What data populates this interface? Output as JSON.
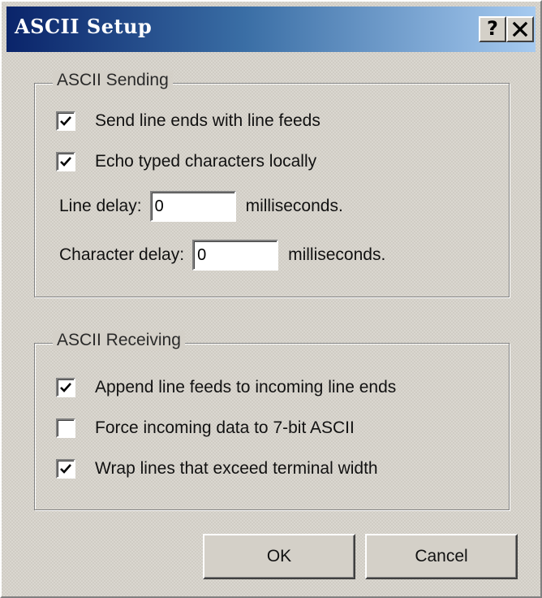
{
  "window": {
    "title": "ASCII Setup",
    "help_glyph": "?",
    "close_glyph": "✕"
  },
  "sending": {
    "legend": "ASCII Sending",
    "send_line_ends": {
      "label": "Send line ends with line feeds",
      "checked": true
    },
    "echo_typed": {
      "label": "Echo typed characters locally",
      "checked": true
    },
    "line_delay": {
      "label": "Line delay:",
      "value": "0",
      "unit": "milliseconds."
    },
    "char_delay": {
      "label": "Character delay:",
      "value": "0",
      "unit": "milliseconds."
    }
  },
  "receiving": {
    "legend": "ASCII Receiving",
    "append_line_feeds": {
      "label": "Append line feeds to incoming line ends",
      "checked": true
    },
    "force_7bit": {
      "label": "Force incoming data to 7-bit ASCII",
      "checked": false
    },
    "wrap_lines": {
      "label": "Wrap lines that exceed terminal width",
      "checked": true
    }
  },
  "buttons": {
    "ok": "OK",
    "cancel": "Cancel"
  },
  "colors": {
    "title_gradient_start": "#0a246a",
    "title_gradient_end": "#a6caf0",
    "face": "#d4d0c8"
  },
  "icons": {
    "check": "checkmark-icon",
    "help": "question-mark-icon",
    "close": "close-x-icon"
  }
}
